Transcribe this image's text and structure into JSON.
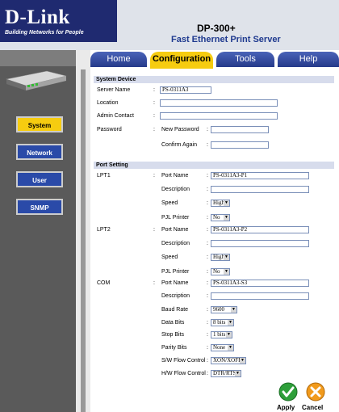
{
  "header": {
    "brand": "D-Link",
    "tagline": "Building Networks for People",
    "model": "DP-300+",
    "product": "Fast Ethernet Print Server"
  },
  "tabs": [
    "Home",
    "Configuration",
    "Tools",
    "Help"
  ],
  "sidebar": {
    "items": [
      "System",
      "Network",
      "User",
      "SNMP"
    ]
  },
  "system_device": {
    "title": "System Device",
    "server_name_label": "Server Name",
    "server_name_value": "PS-0311A3",
    "location_label": "Location",
    "location_value": "",
    "admin_contact_label": "Admin Contact",
    "admin_contact_value": "",
    "password_label": "Password",
    "new_password_label": "New Password",
    "confirm_again_label": "Confirm Again"
  },
  "port_setting": {
    "title": "Port Setting",
    "lpt1": {
      "label": "LPT1",
      "port_name_label": "Port Name",
      "port_name": "PS-0311A3-P1",
      "description_label": "Description",
      "description": "",
      "speed_label": "Speed",
      "speed": "High",
      "pjl_label": "PJL Printer",
      "pjl": "No"
    },
    "lpt2": {
      "label": "LPT2",
      "port_name_label": "Port Name",
      "port_name": "PS-0311A3-P2",
      "description_label": "Description",
      "description": "",
      "speed_label": "Speed",
      "speed": "High",
      "pjl_label": "PJL Printer",
      "pjl": "No"
    },
    "com": {
      "label": "COM",
      "port_name_label": "Port Name",
      "port_name": "PS-0311A3-S3",
      "description_label": "Description",
      "description": "",
      "baud_label": "Baud Rate",
      "baud": "9600",
      "data_bits_label": "Data Bits",
      "data_bits": "8 bits",
      "stop_bits_label": "Stop Bits",
      "stop_bits": "1 bits",
      "parity_label": "Parity Bits",
      "parity": "None",
      "sw_flow_label": "S/W Flow Control",
      "sw_flow": "XON/XOFF",
      "hw_flow_label": "H/W Flow Control",
      "hw_flow": "DTR/RTS"
    }
  },
  "actions": {
    "apply": "Apply",
    "cancel": "Cancel"
  },
  "colors": {
    "accent": "#f6cc10",
    "brand": "#1f2a70",
    "tab": "#253a8a",
    "section": "#d7dcec"
  }
}
